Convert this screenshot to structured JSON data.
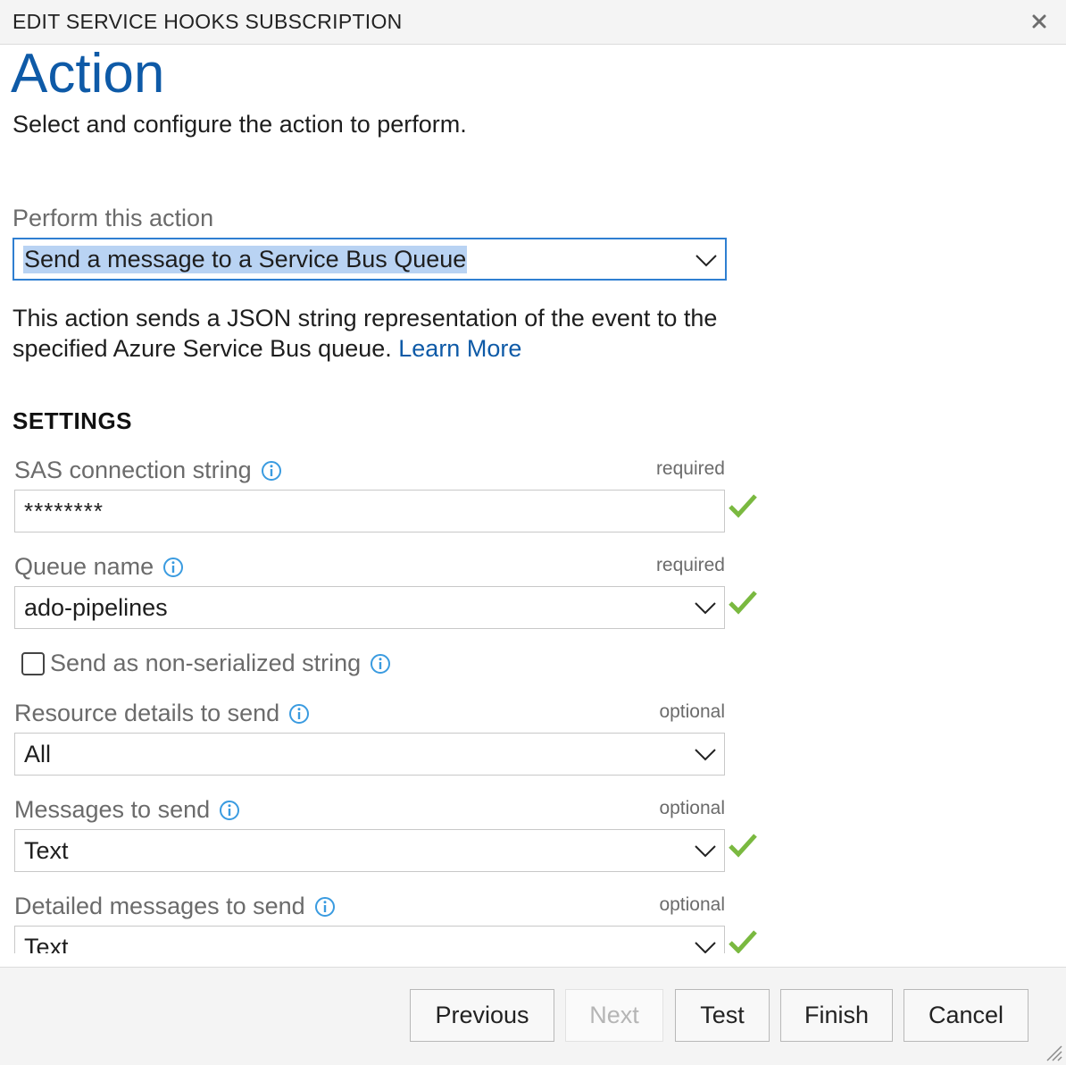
{
  "dialog": {
    "title": "EDIT SERVICE HOOKS SUBSCRIPTION"
  },
  "page": {
    "heading": "Action",
    "subtitle": "Select and configure the action to perform."
  },
  "action": {
    "label": "Perform this action",
    "selected": "Send a message to a Service Bus Queue",
    "description": "This action sends a JSON string representation of the event to the specified Azure Service Bus queue.",
    "learn_more": "Learn More"
  },
  "settings": {
    "heading": "SETTINGS",
    "sas": {
      "label": "SAS connection string",
      "requirement": "required",
      "value": "********"
    },
    "queue": {
      "label": "Queue name",
      "requirement": "required",
      "value": "ado-pipelines"
    },
    "non_serialized": {
      "label": "Send as non-serialized string",
      "checked": false
    },
    "resource_details": {
      "label": "Resource details to send",
      "requirement": "optional",
      "value": "All"
    },
    "messages": {
      "label": "Messages to send",
      "requirement": "optional",
      "value": "Text"
    },
    "detailed_messages": {
      "label": "Detailed messages to send",
      "requirement": "optional",
      "value": "Text"
    }
  },
  "footer": {
    "previous": "Previous",
    "next": "Next",
    "test": "Test",
    "finish": "Finish",
    "cancel": "Cancel"
  },
  "colors": {
    "accent": "#0e5aa7",
    "focus": "#2f7fd1",
    "valid": "#7ab940",
    "info": "#3a9be0"
  },
  "icons": [
    "close-icon",
    "chevron-down-icon",
    "info-icon",
    "checkmark-icon",
    "resize-grip-icon"
  ]
}
